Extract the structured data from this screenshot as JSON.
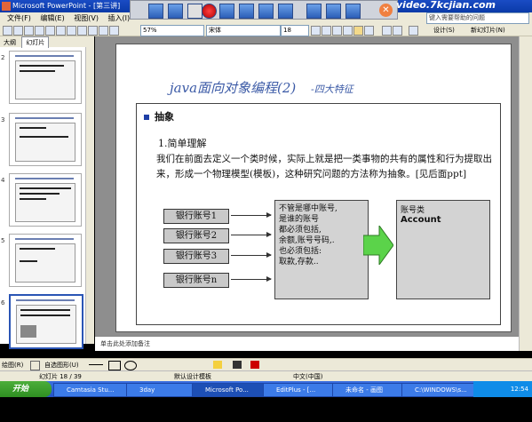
{
  "window": {
    "title": "Microsoft PowerPoint - [第三讲]"
  },
  "watermark": "video.7kcjian.com",
  "ask_box": "键入需要帮助的问题",
  "menu": [
    "文件(F)",
    "编辑(E)",
    "视图(V)",
    "插入(I)"
  ],
  "font": {
    "size": "18",
    "name": "宋体",
    "zoom": "57%"
  },
  "toolbar_labels": {
    "design": "设计(S)",
    "new_slide": "新幻灯片(N)"
  },
  "tabs": [
    "大纲",
    "幻灯片"
  ],
  "thumbnail_numbers": [
    "2",
    "3",
    "4",
    "5",
    "6"
  ],
  "slide": {
    "title": "java面向对象编程(2)",
    "subtitle": "-四大特征",
    "bullet": "抽象",
    "point": "1.简单理解",
    "paragraph": "我们在前面去定义一个类时候，实际上就是把一类事物的共有的属性和行为提取出来，形成一个物理模型(模板)，这种研究问题的方法称为抽象。[见后面ppt]",
    "accounts": [
      "银行账号1",
      "银行账号2",
      "银行账号3",
      "银行账号n"
    ],
    "info_lines": [
      "不管是哪中账号,",
      "是谁的账号",
      "都必须包括,",
      "余额,账号号码,.",
      "也必须包括:",
      "取款,存款.."
    ],
    "class_label": "账号类",
    "class_name": "Account"
  },
  "notes_placeholder": "单击此处添加备注",
  "drawing_toolbar": {
    "draw": "绘图(R)",
    "autoshape": "自选图形(U)"
  },
  "status": {
    "slide_no": "幻灯片 18 / 39",
    "design": "默认设计模板",
    "language": "中文(中国)"
  },
  "taskbar": {
    "start": "开始",
    "tasks": [
      "Camtasia Stu...",
      "3day",
      "Microsoft Po...",
      "EditPlus - [...",
      "未命名 - 画图",
      "C:\\WINDOWS\\s..."
    ],
    "clock": "12:54"
  }
}
